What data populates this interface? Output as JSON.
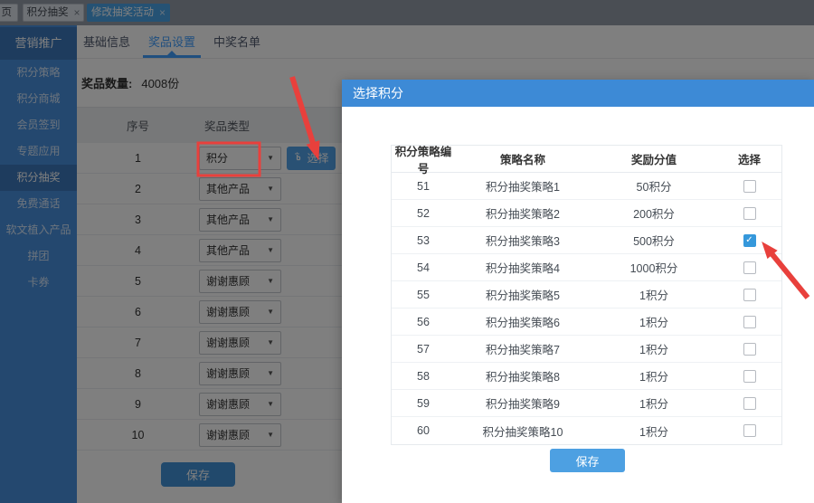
{
  "window_tabs": [
    {
      "label": "页"
    },
    {
      "label": "积分抽奖",
      "close": "×"
    },
    {
      "label": "修改抽奖活动",
      "close": "×",
      "active": true
    }
  ],
  "sidebar": {
    "items": [
      {
        "label": "营销推广",
        "header": true
      },
      {
        "label": "积分策略"
      },
      {
        "label": "积分商城"
      },
      {
        "label": "会员签到"
      },
      {
        "label": "专题应用"
      },
      {
        "label": "积分抽奖",
        "active": true
      },
      {
        "label": "免费通话"
      },
      {
        "label": "软文植入产品"
      },
      {
        "label": "拼团"
      },
      {
        "label": "卡券"
      }
    ]
  },
  "main": {
    "tabs": [
      {
        "label": "基础信息"
      },
      {
        "label": "奖品设置",
        "active": true
      },
      {
        "label": "中奖名单"
      }
    ],
    "quantity_label": "奖品数量:",
    "quantity_value": "4008份",
    "select_button_label": "选择",
    "save_label": "保存",
    "table": {
      "headers": [
        "序号",
        "奖品类型"
      ],
      "rows": [
        {
          "no": "1",
          "type": "积分",
          "has_select_button": true
        },
        {
          "no": "2",
          "type": "其他产品"
        },
        {
          "no": "3",
          "type": "其他产品"
        },
        {
          "no": "4",
          "type": "其他产品"
        },
        {
          "no": "5",
          "type": "谢谢惠顾"
        },
        {
          "no": "6",
          "type": "谢谢惠顾"
        },
        {
          "no": "7",
          "type": "谢谢惠顾"
        },
        {
          "no": "8",
          "type": "谢谢惠顾"
        },
        {
          "no": "9",
          "type": "谢谢惠顾"
        },
        {
          "no": "10",
          "type": "谢谢惠顾"
        }
      ]
    }
  },
  "modal": {
    "title": "选择积分",
    "save_label": "保存",
    "table": {
      "headers": [
        "积分策略编号",
        "策略名称",
        "奖励分值",
        "选择"
      ],
      "rows": [
        {
          "id": "51",
          "name": "积分抽奖策略1",
          "value": "50积分",
          "checked": false
        },
        {
          "id": "52",
          "name": "积分抽奖策略2",
          "value": "200积分",
          "checked": false
        },
        {
          "id": "53",
          "name": "积分抽奖策略3",
          "value": "500积分",
          "checked": true
        },
        {
          "id": "54",
          "name": "积分抽奖策略4",
          "value": "1000积分",
          "checked": false
        },
        {
          "id": "55",
          "name": "积分抽奖策略5",
          "value": "1积分",
          "checked": false
        },
        {
          "id": "56",
          "name": "积分抽奖策略6",
          "value": "1积分",
          "checked": false
        },
        {
          "id": "57",
          "name": "积分抽奖策略7",
          "value": "1积分",
          "checked": false
        },
        {
          "id": "58",
          "name": "积分抽奖策略8",
          "value": "1积分",
          "checked": false
        },
        {
          "id": "59",
          "name": "积分抽奖策略9",
          "value": "1积分",
          "checked": false
        },
        {
          "id": "60",
          "name": "积分抽奖策略10",
          "value": "1积分",
          "checked": false
        }
      ]
    }
  },
  "icons": {
    "dropdown": "▼",
    "checkmark": "✓",
    "hand_click": "hand-click-icon"
  },
  "colors": {
    "accent": "#409eff",
    "modal_header": "#3d8ad6",
    "btn_blue": "#52a2e8",
    "save_blue": "#4293d9",
    "modal_save": "#4da0e2",
    "sidebar_bg": "#4890de",
    "sidebar_active": "#3c78bc",
    "topbar_bg": "#949ca8",
    "chip_bg": "#dce2ea",
    "chip_active": "#4aa4e8",
    "annotation_red": "#e8403c",
    "check_blue": "#3598db"
  }
}
